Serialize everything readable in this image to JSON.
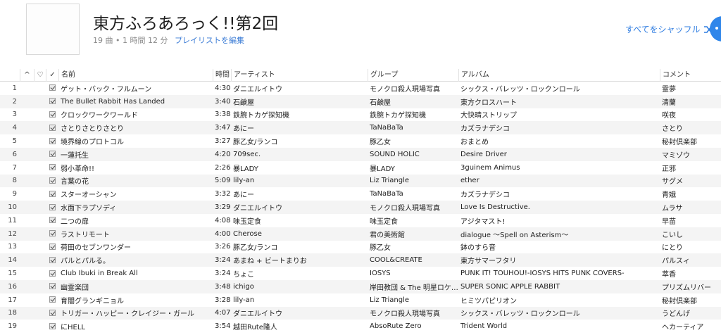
{
  "playlist": {
    "title": "東方ふろあろっく!!第2回",
    "info": "19 曲 • 1 時間 12 分",
    "edit_label": "プレイリストを編集",
    "shuffle_label": "すべてをシャッフル"
  },
  "columns": {
    "sort": "^",
    "heart": "♡",
    "check": "✓",
    "name": "名前",
    "time": "時間",
    "artist": "アーティスト",
    "group": "グループ",
    "album": "アルバム",
    "comment": "コメント"
  },
  "rows": [
    {
      "num": "1",
      "name": "ゲット・バック・フルムーン",
      "time": "4:30",
      "artist": "ダニエルイトウ",
      "group": "モノクロ殺人現場写真",
      "album": "シックス・バレッツ・ロックンロール",
      "comment": "霊夢"
    },
    {
      "num": "2",
      "name": "The Bullet Rabbit Has Landed",
      "time": "3:40",
      "artist": "石鹸屋",
      "group": "石鹸屋",
      "album": "東方クロスハート",
      "comment": "清蘭"
    },
    {
      "num": "3",
      "name": "クロックワークワールド",
      "time": "3:38",
      "artist": "鉄腕トカゲ探知機",
      "group": "鉄腕トカゲ探知機",
      "album": "大快晴ストリップ",
      "comment": "咲夜"
    },
    {
      "num": "4",
      "name": "さとりさとりさとり",
      "time": "3:47",
      "artist": "あにー",
      "group": "TaNaBaTa",
      "album": "カズラナデシコ",
      "comment": "さとり"
    },
    {
      "num": "5",
      "name": "境界線のプロトコル",
      "time": "3:27",
      "artist": "豚乙女/ランコ",
      "group": "豚乙女",
      "album": "おまとめ",
      "comment": "秘封倶楽部"
    },
    {
      "num": "6",
      "name": "一蓮托生",
      "time": "4:20",
      "artist": "709sec.",
      "group": "SOUND HOLIC",
      "album": "Desire Driver",
      "comment": "マミゾウ"
    },
    {
      "num": "7",
      "name": "弱小革命!!",
      "time": "2:26",
      "artist": "暴LADY",
      "group": "暴LADY",
      "album": "3guinem Animus",
      "comment": "正邪"
    },
    {
      "num": "8",
      "name": "言葉の花",
      "time": "5:09",
      "artist": "lily-an",
      "group": "Liz Triangle",
      "album": "ether",
      "comment": "サグメ"
    },
    {
      "num": "9",
      "name": "スターオーシャン",
      "time": "3:32",
      "artist": "あにー",
      "group": "TaNaBaTa",
      "album": "カズラナデシコ",
      "comment": "青娥"
    },
    {
      "num": "10",
      "name": "水面下ラプソディ",
      "time": "3:29",
      "artist": "ダニエルイトウ",
      "group": "モノクロ殺人現場写真",
      "album": "Love Is Destructive.",
      "comment": "ムラサ"
    },
    {
      "num": "11",
      "name": "二つの扉",
      "time": "4:08",
      "artist": "味玉定食",
      "group": "味玉定食",
      "album": "アジタマスト!",
      "comment": "早苗"
    },
    {
      "num": "12",
      "name": "ラストリモート",
      "time": "4:00",
      "artist": "Cherose",
      "group": "君の美術館",
      "album": "dialogue ～Spell on Asterism～",
      "comment": "こいし"
    },
    {
      "num": "13",
      "name": "荷田のセブンワンダー",
      "time": "3:26",
      "artist": "豚乙女/ランコ",
      "group": "豚乙女",
      "album": "鉢のすら音",
      "comment": "にとり"
    },
    {
      "num": "14",
      "name": "パルとパルる。",
      "time": "3:24",
      "artist": "あまね + ビートまりお",
      "group": "COOL&CREATE",
      "album": "東方サマーフタリ",
      "comment": "パルスィ"
    },
    {
      "num": "15",
      "name": "Club Ibuki in Break All",
      "time": "3:24",
      "artist": "ちょこ",
      "group": "IOSYS",
      "album": "PUNK IT! TOUHOU!-IOSYS HITS PUNK COVERS-",
      "comment": "萃香"
    },
    {
      "num": "16",
      "name": "幽霊楽団",
      "time": "3:48",
      "artist": "ichigo",
      "group": "岸田教団 & The 明星ロケ…",
      "album": "SUPER SONIC APPLE RABBIT",
      "comment": "プリズムリバー"
    },
    {
      "num": "17",
      "name": "育闇グランギニョル",
      "time": "3:28",
      "artist": "lily-an",
      "group": "Liz Triangle",
      "album": "ヒミツパピリオン",
      "comment": "秘封倶楽部"
    },
    {
      "num": "18",
      "name": "トリガー・ハッピー・クレイジー・ガール",
      "time": "4:07",
      "artist": "ダニエルイトウ",
      "group": "モノクロ殺人現場写真",
      "album": "シックス・バレッツ・ロックンロール",
      "comment": "うどんげ"
    },
    {
      "num": "19",
      "name": "にHELL",
      "time": "3:54",
      "artist": "越田Rute隆人",
      "group": "AbsoRute Zero",
      "album": "Trident World",
      "comment": "ヘカーティア"
    }
  ],
  "icons": {
    "shuffle": "shuffle-icon",
    "more": "more-icon",
    "check": "checkbox-icon"
  },
  "colors": {
    "accent": "#2f7de1",
    "row_alt": "#f4f4f4"
  }
}
